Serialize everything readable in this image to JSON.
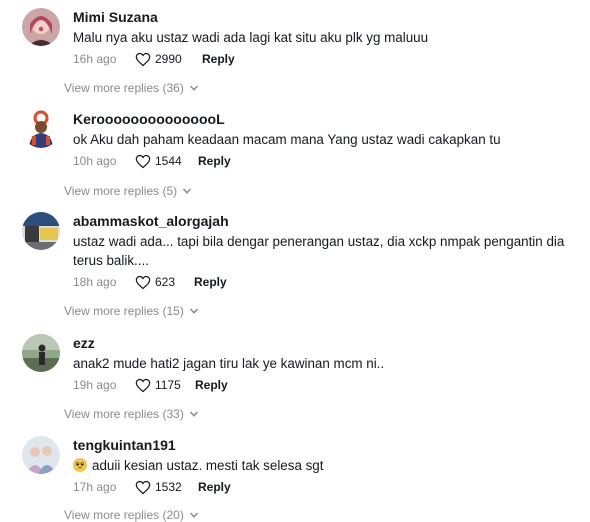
{
  "comments": [
    {
      "username": "Mimi Suzana",
      "text": "Malu nya aku ustaz wadi ada lagi kat situ aku plk yg maluuu",
      "time": "16h ago",
      "likes": "2990",
      "reply_label": "Reply",
      "more_replies": "View more replies (36)"
    },
    {
      "username": "KerooooooooooooooL",
      "text": "ok Aku dah paham keadaan macam mana Yang ustaz wadi cakapkan tu",
      "time": "10h ago",
      "likes": "1544",
      "reply_label": "Reply",
      "more_replies": "View more replies (5)"
    },
    {
      "username": "abammaskot_alorgajah",
      "text": "ustaz wadi ada... tapi bila dengar penerangan ustaz, dia xckp nmpak pengantin dia terus balik....",
      "time": "18h ago",
      "likes": "623",
      "reply_label": "Reply",
      "more_replies": "View more replies (15)"
    },
    {
      "username": "ezz",
      "text": "anak2 mude hati2 jagan tiru lak ye kawinan mcm ni..",
      "time": "19h ago",
      "likes": "1175",
      "reply_label": "Reply",
      "more_replies": "View more replies (33)"
    },
    {
      "username": "tengkuintan191",
      "text": "aduii kesian ustaz. mesti tak selesa sgt",
      "emoji": "pleading-face-emoji",
      "time": "17h ago",
      "likes": "1532",
      "reply_label": "Reply",
      "more_replies": "View more replies (20)"
    }
  ],
  "colors": {
    "text_primary": "#161823",
    "text_secondary": "#8a8b91",
    "background": "#ffffff"
  }
}
